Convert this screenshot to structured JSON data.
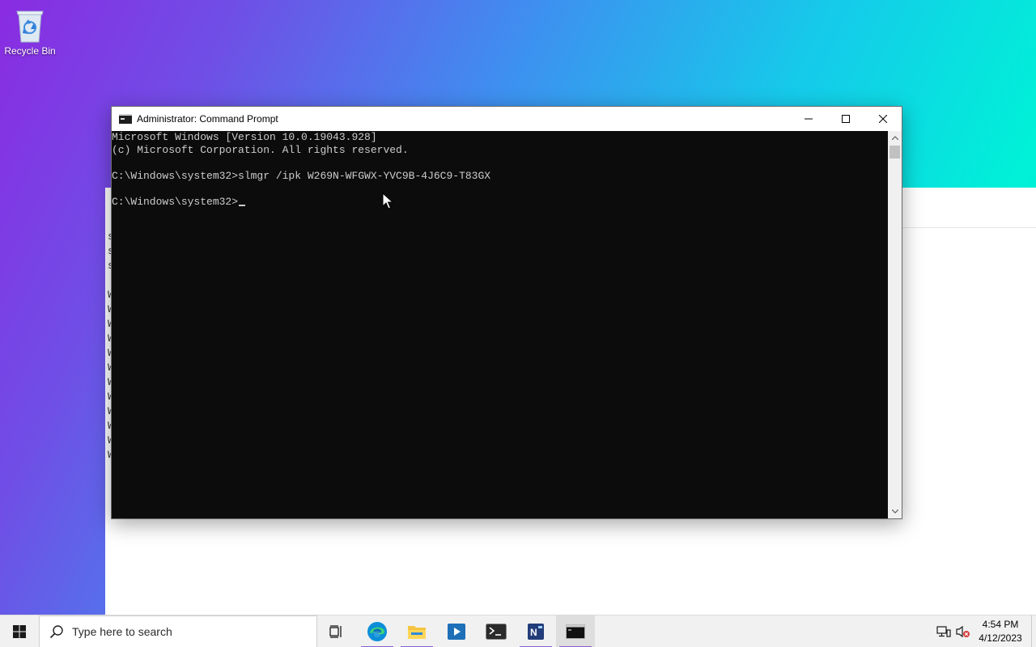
{
  "desktop": {
    "icons": [
      {
        "label": "Recycle Bin",
        "icon": "recycle-bin-icon"
      }
    ]
  },
  "background_window": {
    "left_edge_letters": [
      "s",
      "s",
      "s",
      "",
      "W",
      "W",
      "W",
      "W",
      "W",
      "W",
      "W",
      "W",
      "W",
      "W",
      "W",
      "W"
    ]
  },
  "cmd_window": {
    "title": "Administrator: Command Prompt",
    "controls": {
      "minimize": "minimize-icon",
      "maximize": "maximize-icon",
      "close": "close-icon"
    },
    "lines": [
      "Microsoft Windows [Version 10.0.19043.928]",
      "(c) Microsoft Corporation. All rights reserved.",
      "",
      "C:\\Windows\\system32>slmgr /ipk W269N-WFGWX-YVC9B-4J6C9-T83GX",
      ""
    ],
    "prompt": "C:\\Windows\\system32>",
    "colors": {
      "background": "#0c0c0c",
      "text": "#cccccc"
    }
  },
  "taskbar": {
    "start_icon": "windows-start-icon",
    "search_placeholder": "Type here to search",
    "items": [
      {
        "name": "task-view",
        "icon": "task-view-icon",
        "running": false
      },
      {
        "name": "edge",
        "icon": "edge-icon",
        "running": true
      },
      {
        "name": "file-explorer",
        "icon": "folder-icon",
        "running": true
      },
      {
        "name": "media-player",
        "icon": "media-player-icon",
        "running": false
      },
      {
        "name": "powershell",
        "icon": "terminal-icon",
        "running": false
      },
      {
        "name": "notepad-plus",
        "icon": "notepad-icon",
        "running": true
      },
      {
        "name": "command-prompt",
        "icon": "cmd-icon",
        "running": true,
        "active": true
      }
    ],
    "tray": {
      "network_icon": "network-icon",
      "volume_icon": "volume-muted-icon",
      "time": "4:54 PM",
      "date": "4/12/2023"
    },
    "accent_color": "#8a5fc9"
  }
}
